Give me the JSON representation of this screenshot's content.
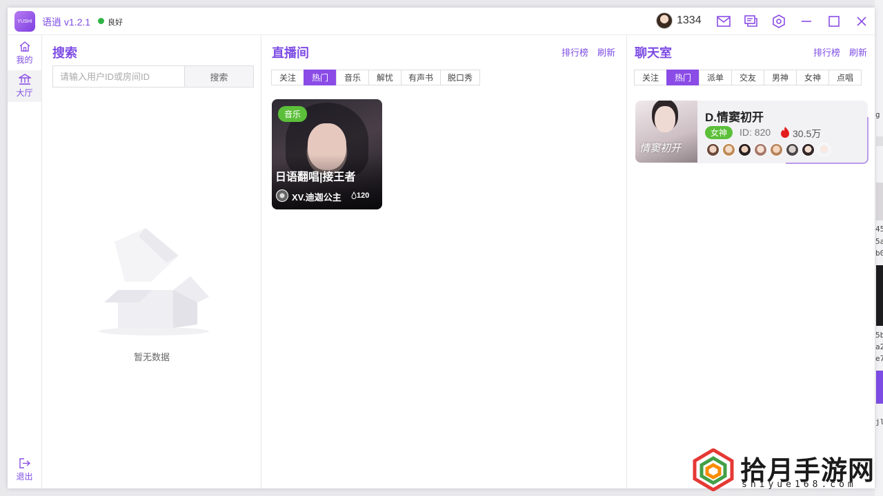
{
  "app": {
    "logo_text": "YUSHI",
    "title": "语逍 v1.2.1",
    "status": "良好",
    "coins": "1334"
  },
  "nav": {
    "items": [
      {
        "label": "我的",
        "icon": "home-icon"
      },
      {
        "label": "大厅",
        "icon": "bank-icon"
      }
    ],
    "logout_label": "退出"
  },
  "search": {
    "title": "搜索",
    "placeholder": "请输入用户ID或房间ID",
    "button": "搜索",
    "empty_text": "暂无数据"
  },
  "live": {
    "title": "直播间",
    "ranking": "排行榜",
    "refresh": "刷新",
    "tabs": [
      "关注",
      "热门",
      "音乐",
      "解忧",
      "有声书",
      "脱口秀"
    ],
    "active_tab": "热门",
    "rooms": [
      {
        "tag": "音乐",
        "title": "日语翻唱|接王者",
        "host": "XV.迪迦公主",
        "heat": "120"
      }
    ]
  },
  "chat": {
    "title": "聊天室",
    "ranking": "排行榜",
    "refresh": "刷新",
    "tabs": [
      "关注",
      "热门",
      "派单",
      "交友",
      "男神",
      "女神",
      "点唱"
    ],
    "active_tab": "热门",
    "rooms": [
      {
        "name": "D.情窦初开",
        "cover_text": "情窦初开",
        "badge": "女神",
        "id": "ID: 820",
        "heat": "30.5万",
        "member_count": 8
      }
    ]
  },
  "watermark": {
    "text": "拾月手游网",
    "url": "shiyue168.com"
  },
  "background": {
    "fragments": [
      "g",
      "45",
      "5a",
      "b0",
      "5b",
      "a2",
      "e7",
      "jl"
    ]
  },
  "colors": {
    "accent": "#7d4ce4",
    "tab_active": "#8a4be6",
    "tag_green": "#5cbf3a",
    "status_green": "#2fb344"
  }
}
